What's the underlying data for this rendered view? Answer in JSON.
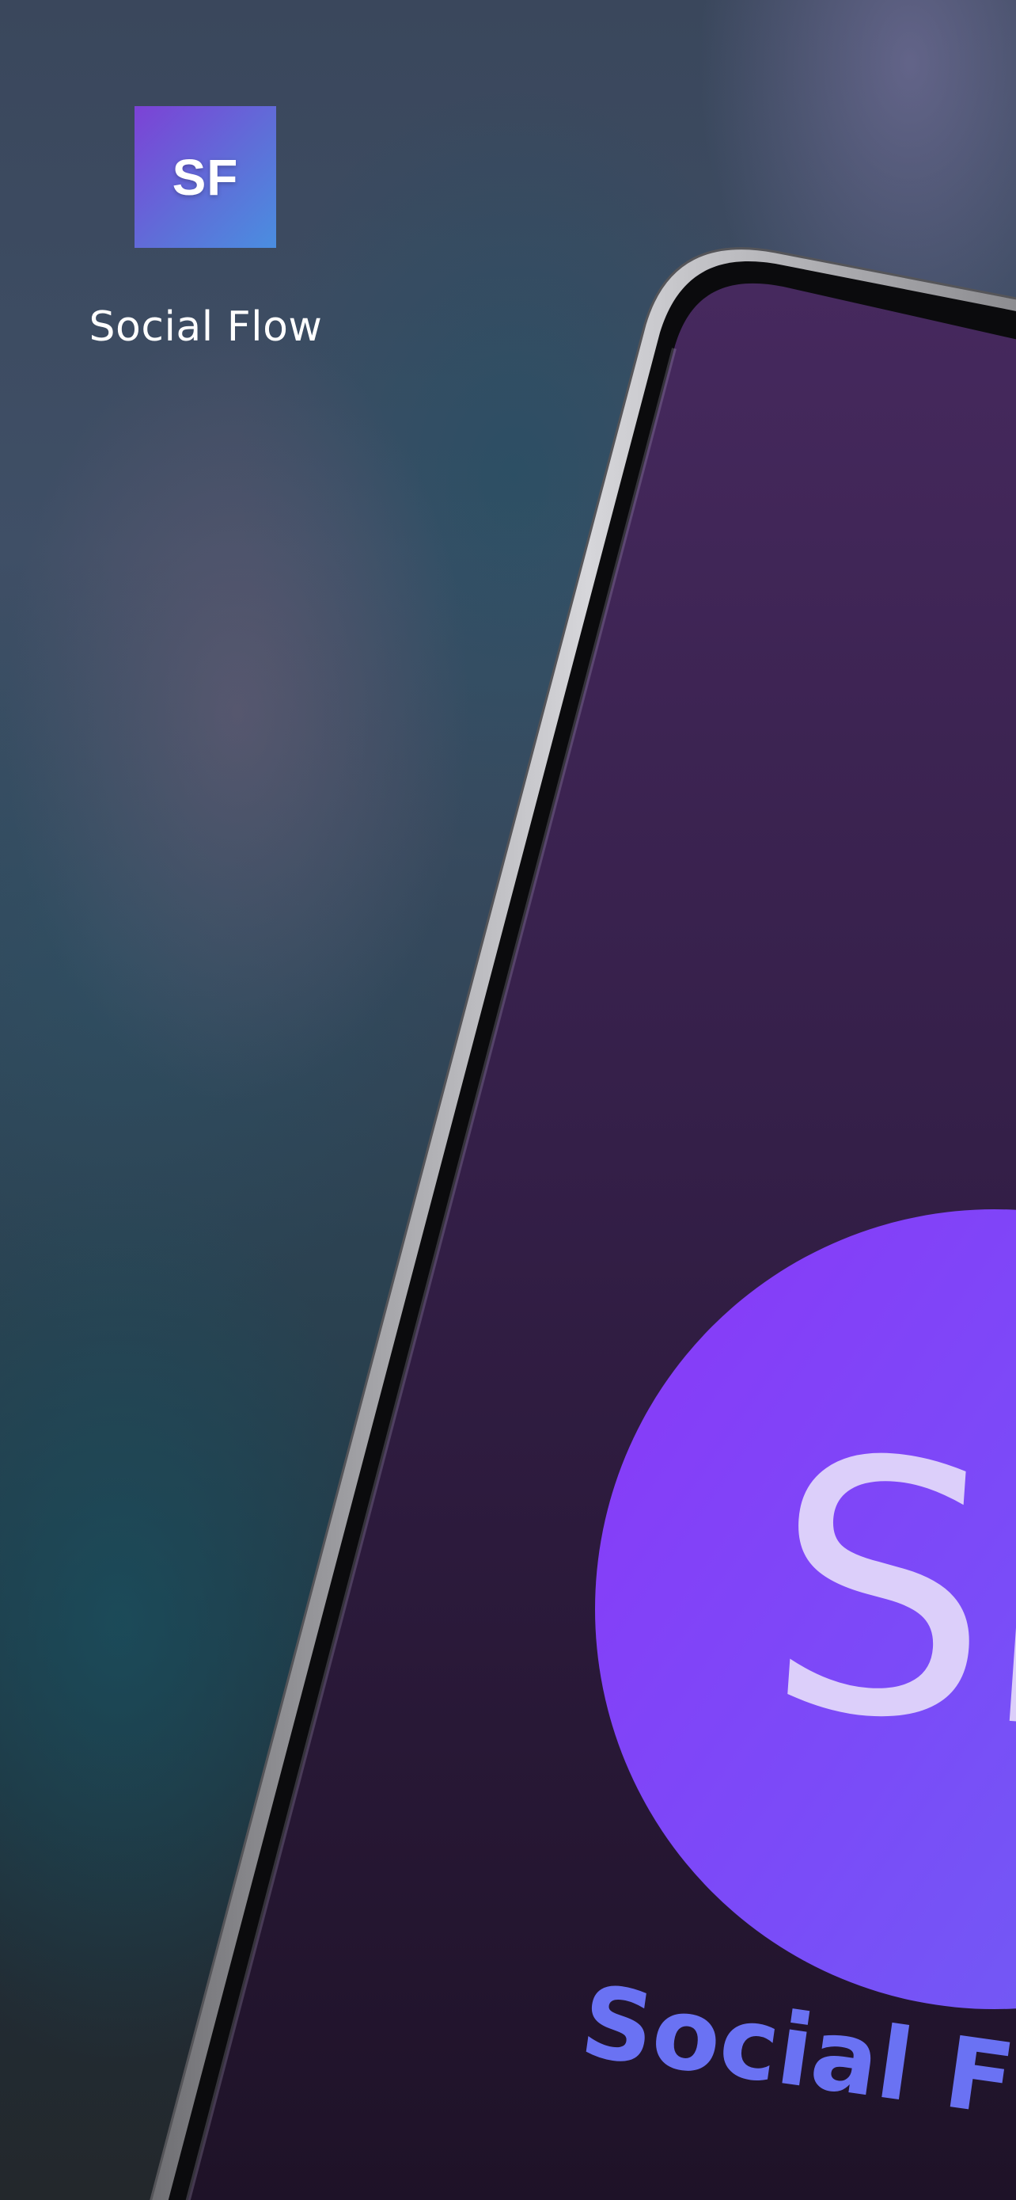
{
  "app": {
    "icon_text": "SF",
    "name": "Social Flow"
  },
  "device_screen": {
    "logo_text": "SF",
    "title": "Social Flow"
  },
  "colors": {
    "icon_gradient_start": "#7c42d6",
    "icon_gradient_end": "#4a8ee0",
    "logo_circle": "#8a38f8",
    "screen_background": "#3a2550",
    "screen_title": "#6a72f3"
  }
}
